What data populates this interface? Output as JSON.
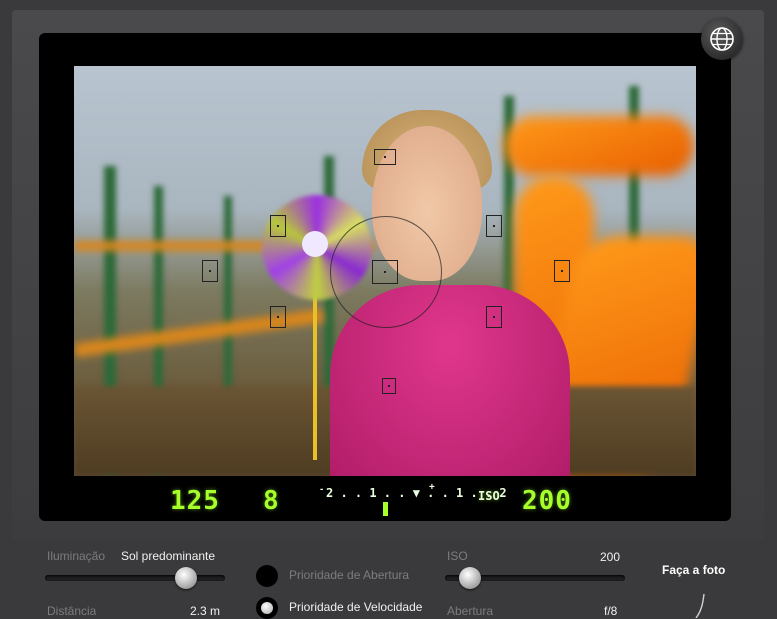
{
  "display": {
    "shutter": "125",
    "aperture": "8",
    "meter_scale": "2 . . 1 . . ▼ . . 1 . . 2",
    "meter_sign_minus": "-",
    "meter_sign_plus": "+",
    "iso_label": "ISO",
    "iso_value": "200"
  },
  "colors": {
    "lcd": "#a6ff2a",
    "background": "#3a3a3c"
  },
  "controls": {
    "lighting": {
      "label": "Iluminação",
      "value": "Sol predominante",
      "slider_level": 0.7
    },
    "distance": {
      "label": "Distância",
      "value": "2.3 m"
    },
    "mode": {
      "options": [
        {
          "label": "Prioridade de Abertura",
          "selected": false
        },
        {
          "label": "Prioridade de Velocidade",
          "selected": true
        }
      ]
    },
    "iso": {
      "label": "ISO",
      "value": "200",
      "slider_level": 0.1
    },
    "aperture": {
      "label": "Abertura",
      "value": "f/8"
    },
    "shoot_label": "Faça a foto"
  },
  "icons": {
    "globe": "globe-icon"
  }
}
